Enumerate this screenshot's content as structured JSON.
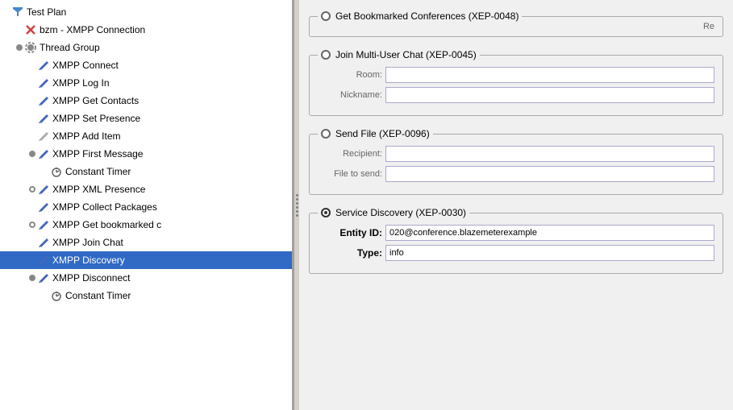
{
  "tree": {
    "items": [
      {
        "id": "test-plan",
        "label": "Test Plan",
        "indent": 0,
        "iconType": "testplan",
        "expanded": true,
        "selected": false
      },
      {
        "id": "bzm-xmpp",
        "label": "bzm - XMPP Connection",
        "indent": 1,
        "iconType": "wrench",
        "selected": false
      },
      {
        "id": "thread-group",
        "label": "Thread Group",
        "indent": 1,
        "iconType": "gear",
        "connector": "circle",
        "selected": false
      },
      {
        "id": "xmpp-connect",
        "label": "XMPP Connect",
        "indent": 2,
        "iconType": "pencil",
        "selected": false
      },
      {
        "id": "xmpp-login",
        "label": "XMPP Log In",
        "indent": 2,
        "iconType": "pencil",
        "selected": false
      },
      {
        "id": "xmpp-contacts",
        "label": "XMPP Get Contacts",
        "indent": 2,
        "iconType": "pencil",
        "selected": false
      },
      {
        "id": "xmpp-presence",
        "label": "XMPP Set Presence",
        "indent": 2,
        "iconType": "pencil",
        "selected": false
      },
      {
        "id": "xmpp-add-item",
        "label": "XMPP Add Item",
        "indent": 2,
        "iconType": "pencil-gray",
        "selected": false
      },
      {
        "id": "xmpp-first-msg",
        "label": "XMPP First Message",
        "indent": 2,
        "iconType": "pencil",
        "connector": "circle",
        "selected": false
      },
      {
        "id": "constant-timer-1",
        "label": "Constant Timer",
        "indent": 3,
        "iconType": "timer",
        "selected": false
      },
      {
        "id": "xmpp-xml-presence",
        "label": "XMPP XML Presence",
        "indent": 2,
        "iconType": "pencil",
        "connector": "circle-open",
        "selected": false
      },
      {
        "id": "xmpp-collect",
        "label": "XMPP Collect Packages",
        "indent": 2,
        "iconType": "pencil",
        "selected": false
      },
      {
        "id": "xmpp-bookmarked",
        "label": "XMPP Get bookmarked c",
        "indent": 2,
        "iconType": "pencil",
        "connector": "circle-open",
        "selected": false
      },
      {
        "id": "xmpp-join-chat",
        "label": "XMPP Join Chat",
        "indent": 2,
        "iconType": "pencil",
        "selected": false
      },
      {
        "id": "xmpp-discovery",
        "label": "XMPP Discovery",
        "indent": 2,
        "iconType": "pencil",
        "selected": true
      },
      {
        "id": "xmpp-disconnect",
        "label": "XMPP Disconnect",
        "indent": 2,
        "iconType": "pencil",
        "connector": "circle",
        "selected": false
      },
      {
        "id": "constant-timer-2",
        "label": "Constant Timer",
        "indent": 3,
        "iconType": "timer",
        "selected": false
      }
    ]
  },
  "right_panel": {
    "sections": [
      {
        "id": "get-bookmarked",
        "title": "Get Bookmarked Conferences (XEP-0048)",
        "radio_selected": false,
        "partial_label": "Re",
        "fields": []
      },
      {
        "id": "join-multi-user",
        "title": "Join Multi-User Chat (XEP-0045)",
        "radio_selected": false,
        "fields": [
          {
            "label": "Room:",
            "value": "",
            "id": "room-field"
          },
          {
            "label": "Nickname:",
            "value": "",
            "id": "nickname-field"
          }
        ]
      },
      {
        "id": "send-file",
        "title": "Send File (XEP-0096)",
        "radio_selected": false,
        "fields": [
          {
            "label": "Recipient:",
            "value": "",
            "id": "recipient-field"
          },
          {
            "label": "File to send:",
            "value": "",
            "id": "file-field"
          }
        ]
      },
      {
        "id": "service-discovery",
        "title": "Service Discovery (XEP-0030)",
        "radio_selected": true,
        "fields": [
          {
            "label": "Entity ID:",
            "value": "020@conference.blazemeterexample",
            "id": "entity-id-field",
            "bold": true
          },
          {
            "label": "Type:",
            "value": "info",
            "id": "type-field",
            "bold": true
          }
        ]
      }
    ]
  }
}
